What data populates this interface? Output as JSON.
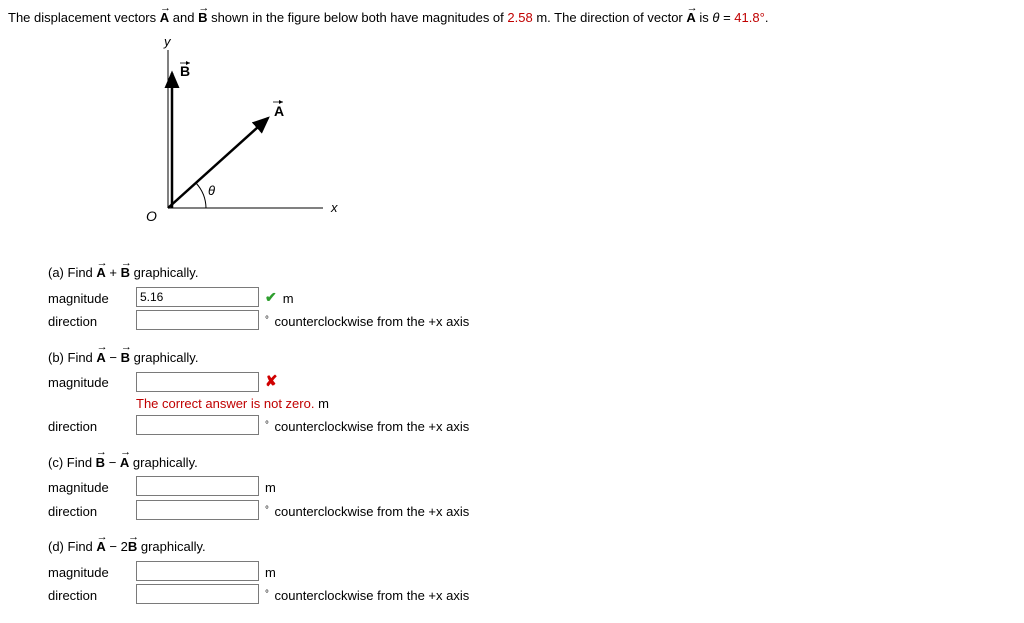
{
  "statement": {
    "pre": "The displacement vectors ",
    "and": " and ",
    "post_vectors": " shown in the figure below both have magnitudes of ",
    "magnitude_value": "2.58",
    "post_magnitude": " m. The direction of vector ",
    "is": " is ",
    "theta": "θ",
    "equals": " = ",
    "angle_value": "41.8",
    "degree": "°",
    "period": "."
  },
  "figure": {
    "y_label": "y",
    "x_label": "x",
    "A_label": "A",
    "B_label": "B",
    "O_label": "O",
    "theta_label": "θ"
  },
  "parts": {
    "a": {
      "title_prefix": "(a) Find ",
      "op": " + ",
      "title_suffix": " graphically.",
      "magnitude_label": "magnitude",
      "direction_label": "direction",
      "magnitude_value": "5.16",
      "direction_value": "",
      "mag_unit": "m",
      "dir_unit": " counterclockwise from the +x axis",
      "feedback": ""
    },
    "b": {
      "title_prefix": "(b) Find ",
      "op": " − ",
      "title_suffix": " graphically.",
      "magnitude_label": "magnitude",
      "direction_label": "direction",
      "magnitude_value": "",
      "direction_value": "",
      "mag_unit": " m",
      "dir_unit": " counterclockwise from the +x axis",
      "feedback": "The correct answer is not zero."
    },
    "c": {
      "title_prefix": "(c) Find ",
      "op": " − ",
      "title_suffix": " graphically.",
      "magnitude_label": "magnitude",
      "direction_label": "direction",
      "magnitude_value": "",
      "direction_value": "",
      "mag_unit": "m",
      "dir_unit": " counterclockwise from the +x axis"
    },
    "d": {
      "title_prefix": "(d) Find ",
      "op": " − 2",
      "title_suffix": " graphically.",
      "magnitude_label": "magnitude",
      "direction_label": "direction",
      "magnitude_value": "",
      "direction_value": "",
      "mag_unit": "m",
      "dir_unit": " counterclockwise from the +x axis"
    }
  },
  "deg_symbol": "°"
}
